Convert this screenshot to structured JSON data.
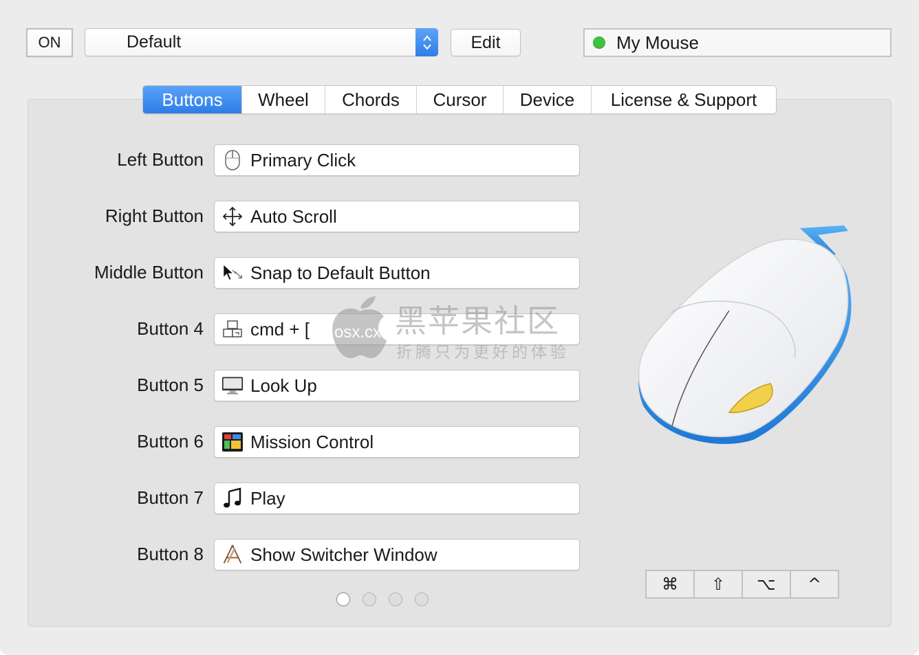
{
  "toolbar": {
    "power_label": "ON",
    "preset_value": "Default",
    "edit_label": "Edit",
    "device_name": "My Mouse",
    "device_status_color": "#3fc23f"
  },
  "tabs": [
    {
      "label": "Buttons",
      "active": true
    },
    {
      "label": "Wheel",
      "active": false
    },
    {
      "label": "Chords",
      "active": false
    },
    {
      "label": "Cursor",
      "active": false
    },
    {
      "label": "Device",
      "active": false
    },
    {
      "label": "License & Support",
      "active": false
    }
  ],
  "buttons": [
    {
      "label": "Left Button",
      "action": "Primary Click",
      "icon": "mouse-icon"
    },
    {
      "label": "Right Button",
      "action": "Auto Scroll",
      "icon": "move-arrows-icon"
    },
    {
      "label": "Middle Button",
      "action": "Snap to Default Button",
      "icon": "snap-cursor-icon"
    },
    {
      "label": "Button 4",
      "action": "cmd + [",
      "icon": "keyboard-shortcut-icon"
    },
    {
      "label": "Button 5",
      "action": "Look Up",
      "icon": "display-icon"
    },
    {
      "label": "Button 6",
      "action": "Mission Control",
      "icon": "mission-control-icon"
    },
    {
      "label": "Button 7",
      "action": "Play",
      "icon": "music-note-icon"
    },
    {
      "label": "Button 8",
      "action": "Show Switcher Window",
      "icon": "app-switcher-icon"
    }
  ],
  "pager": {
    "pages": 4,
    "current": 1
  },
  "modifiers": [
    {
      "name": "command",
      "glyph": "⌘"
    },
    {
      "name": "shift",
      "glyph": "⇧"
    },
    {
      "name": "option",
      "glyph": "⌥"
    },
    {
      "name": "control",
      "glyph": "^"
    }
  ],
  "watermark": {
    "title": "黑苹果社区",
    "subtitle": "折腾只为更好的体验",
    "domain": "osx.cx"
  },
  "colors": {
    "accent": "#2f7fe8",
    "mouse_accent": "#2a8be0",
    "mouse_button_highlight": "#f2d04a"
  }
}
